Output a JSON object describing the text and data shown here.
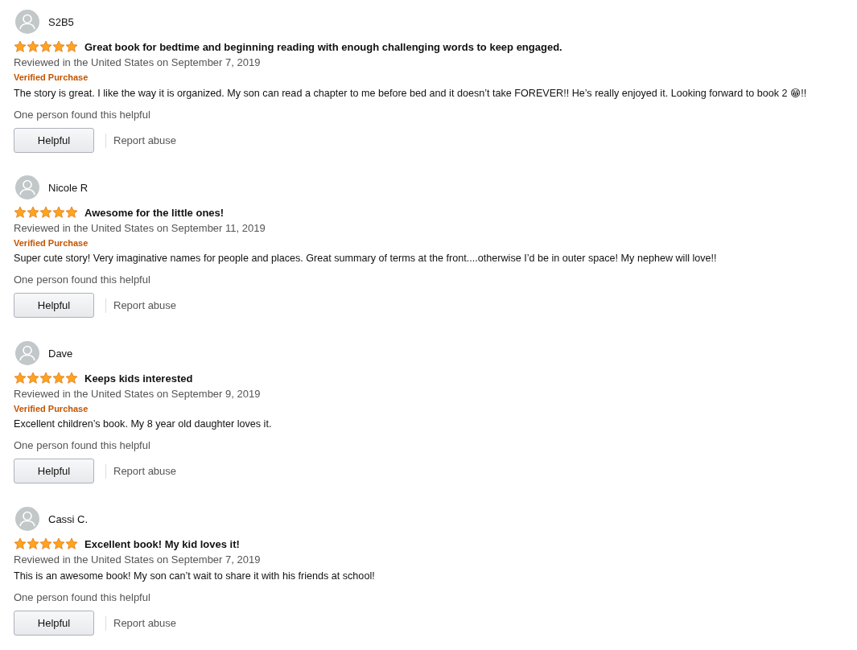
{
  "reviews": [
    {
      "author": "S2B5",
      "stars": 5,
      "title": "Great book for bedtime and beginning reading with enough challenging words to keep engaged.",
      "date": "Reviewed in the United States on September 7, 2019",
      "verified": "Verified Purchase",
      "body": "The story is great. I like the way it is organized. My son can read a chapter to me before bed and it doesn’t take FOREVER!! He’s really enjoyed it. Looking forward to book 2 😁!!",
      "helpful_count": "One person found this helpful",
      "helpful_button": "Helpful",
      "report": "Report abuse"
    },
    {
      "author": "Nicole R",
      "stars": 5,
      "title": "Awesome for the little ones!",
      "date": "Reviewed in the United States on September 11, 2019",
      "verified": "Verified Purchase",
      "body": "Super cute story! Very imaginative names for people and places. Great summary of terms at the front....otherwise I’d be in outer space! My nephew will love!!",
      "helpful_count": "One person found this helpful",
      "helpful_button": "Helpful",
      "report": "Report abuse"
    },
    {
      "author": "Dave",
      "stars": 5,
      "title": "Keeps kids interested",
      "date": "Reviewed in the United States on September 9, 2019",
      "verified": "Verified Purchase",
      "body": "Excellent children’s book. My 8 year old daughter loves it.",
      "helpful_count": "One person found this helpful",
      "helpful_button": "Helpful",
      "report": "Report abuse"
    },
    {
      "author": "Cassi C.",
      "stars": 5,
      "title": "Excellent book! My kid loves it!",
      "date": "Reviewed in the United States on September 7, 2019",
      "body": "This is an awesome book! My son can’t wait to share it with his friends at school!",
      "helpful_count": "One person found this helpful",
      "helpful_button": "Helpful",
      "report": "Report abuse"
    }
  ]
}
